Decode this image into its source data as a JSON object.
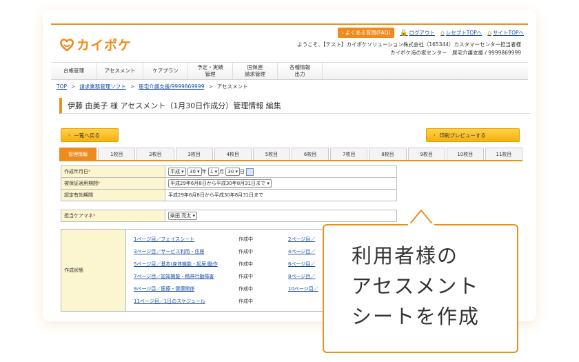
{
  "header": {
    "logo_text": "カイポケ",
    "faq_label": "よくある質問(FAQ)",
    "links": [
      {
        "label": "ログアウト",
        "icon": "lock-icon"
      },
      {
        "label": "レセプトTOPへ",
        "icon": "home-icon"
      },
      {
        "label": "サイトTOPへ",
        "icon": "home-icon"
      }
    ],
    "user_line1": "ようこそ、【テスト】カイポケソリューション株式会社（165344）カスタマーセンター担当者様",
    "user_line2": "カイポケ海の家センター　居宅介護支援 / 9999869999"
  },
  "menu": [
    "台帳管理",
    "アセスメント",
    "ケアプラン",
    "予定・実績\n管理",
    "国保連\n請求管理",
    "各種情報\n出力"
  ],
  "breadcrumb": {
    "items": [
      "TOP",
      "請求業務管理ソフト",
      "居宅介護支援/9999869999",
      "アセスメント"
    ],
    "sep": ">"
  },
  "page_title": "伊藤 由美子 様 アセスメント（1月30日作成分）管理情報 編集",
  "buttons": {
    "back": "一覧へ戻る",
    "print": "印刷プレビューする",
    "arrow": "›"
  },
  "tabs": [
    "管理情報",
    "1枚目",
    "2枚目",
    "3枚目",
    "4枚目",
    "5枚目",
    "6枚目",
    "7枚目",
    "8枚目",
    "9枚目",
    "10枚目",
    "11枚目"
  ],
  "form": {
    "created_date": {
      "label": "作成年月日",
      "era": "平成",
      "year": "30",
      "year_unit": "年",
      "month": "1",
      "month_unit": "月",
      "day": "30",
      "day_unit": "日"
    },
    "insurance_period": {
      "label": "被保証適用期間",
      "value": "平成29年6月8日から平成30年8月31日まで"
    },
    "certified_period": {
      "label": "認定有効期間",
      "value": "平成29年6月8日から平成30年8月31日まで"
    },
    "care_manager": {
      "label": "担当ケアマネ",
      "value": "柴田 亮太"
    },
    "required_mark": "*"
  },
  "status": {
    "label": "作成状態",
    "rows": [
      {
        "left": "1ページ目／フェイスシート",
        "state": "作成中",
        "right": "2ページ目／"
      },
      {
        "left": "3ページ目／サービス利用・住居",
        "state": "作成中",
        "right": "4ページ目／"
      },
      {
        "left": "5ページ目／基本(身体機能・起居)動作",
        "state": "作成中",
        "right": "6ページ目／"
      },
      {
        "left": "7ページ目／認知機能・精神行動障害",
        "state": "作成中",
        "right": "8ページ目／"
      },
      {
        "left": "9ページ目／医療・健康関係",
        "state": "作成中",
        "right": "10ページ目／"
      },
      {
        "left": "11ページ目／1日のスケジュール",
        "state": "作成中",
        "right": ""
      }
    ]
  },
  "callout": {
    "line1": "利用者様の",
    "line2": "アセスメント",
    "line3": "シートを作成"
  },
  "colors": {
    "accent": "#e8921e",
    "link": "#1a4fa8",
    "label_bg": "#fbf6cf",
    "button": "#f6b10e"
  }
}
